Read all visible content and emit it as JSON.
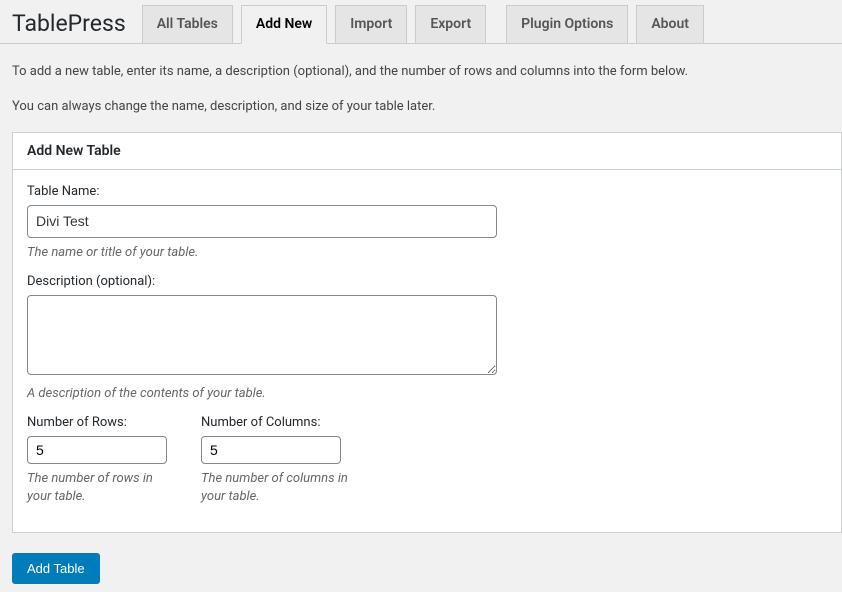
{
  "header": {
    "title": "TablePress",
    "tabs": [
      {
        "label": "All Tables",
        "active": false
      },
      {
        "label": "Add New",
        "active": true
      },
      {
        "label": "Import",
        "active": false
      },
      {
        "label": "Export",
        "active": false
      },
      {
        "label": "Plugin Options",
        "active": false
      },
      {
        "label": "About",
        "active": false
      }
    ]
  },
  "intro": {
    "line1": "To add a new table, enter its name, a description (optional), and the number of rows and columns into the form below.",
    "line2": "You can always change the name, description, and size of your table later."
  },
  "form": {
    "box_title": "Add New Table",
    "name": {
      "label": "Table Name:",
      "value": "Divi Test",
      "hint": "The name or title of your table."
    },
    "description": {
      "label": "Description (optional):",
      "value": "",
      "hint": "A description of the contents of your table."
    },
    "rows": {
      "label": "Number of Rows:",
      "value": "5",
      "hint": "The number of rows in your table."
    },
    "columns": {
      "label": "Number of Columns:",
      "value": "5",
      "hint": "The number of columns in your table."
    }
  },
  "submit": {
    "label": "Add Table"
  }
}
